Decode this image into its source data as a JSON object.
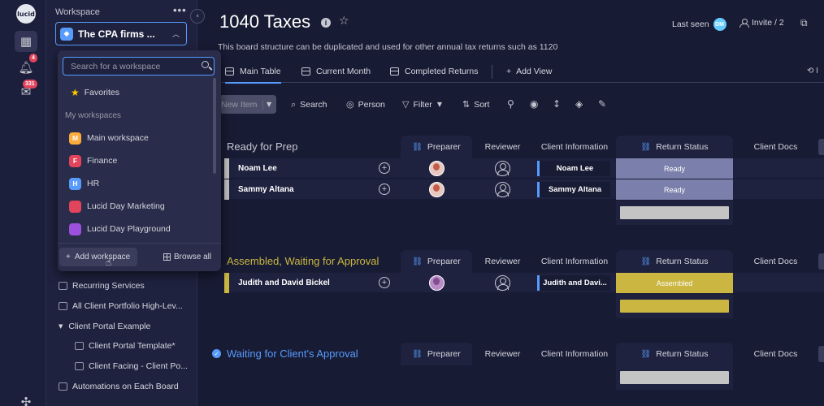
{
  "rail": {
    "logo": "lucid",
    "notifications_badge": "4",
    "inbox_badge": "331"
  },
  "workspace_panel": {
    "label": "Workspace",
    "selected_workspace": "The CPA firms ...",
    "items": [
      {
        "label": "Recurring Services"
      },
      {
        "label": "All Client Portfolio High-Lev..."
      },
      {
        "label": "Client Portal Example"
      },
      {
        "label": "Client Portal Template*"
      },
      {
        "label": "Client Facing - Client Po..."
      },
      {
        "label": "Automations on Each Board"
      }
    ]
  },
  "dropdown": {
    "search_placeholder": "Search for a workspace",
    "favorites": "Favorites",
    "section_label": "My workspaces",
    "workspaces": [
      {
        "initial": "M",
        "label": "Main workspace",
        "color": "#fdab3d"
      },
      {
        "initial": "F",
        "label": "Finance",
        "color": "#e2445c"
      },
      {
        "initial": "H",
        "label": "HR",
        "color": "#579bfc"
      },
      {
        "initial": "",
        "label": "Lucid Day Marketing",
        "color": "#e2445c"
      },
      {
        "initial": "",
        "label": "Lucid Day Playground",
        "color": "#9d50dd"
      }
    ],
    "add_workspace": "Add workspace",
    "browse_all": "Browse all"
  },
  "board": {
    "title": "1040 Taxes",
    "description": "This board structure can be duplicated and used for other annual tax returns such as 1120",
    "last_seen": "Last seen",
    "last_seen_avatar": "DM",
    "invite": "Invite / 2"
  },
  "tabs": [
    {
      "label": "Main Table"
    },
    {
      "label": "Current Month"
    },
    {
      "label": "Completed Returns"
    },
    {
      "label": "Add View"
    }
  ],
  "toolbar": {
    "new_item": "New Item",
    "search": "Search",
    "person": "Person",
    "filter": "Filter",
    "sort": "Sort"
  },
  "columns": {
    "preparer": "Preparer",
    "reviewer": "Reviewer",
    "client_information": "Client Information",
    "return_status": "Return Status",
    "client_docs": "Client Docs"
  },
  "groups": [
    {
      "title": "Ready for Prep",
      "color": "#c4c4c4",
      "rows": [
        {
          "name": "Noam Lee",
          "client_info": "Noam Lee",
          "status": "Ready",
          "status_color": "#7b7fab"
        },
        {
          "name": "Sammy Altana",
          "client_info": "Sammy Altana",
          "status": "Ready",
          "status_color": "#7b7fab"
        }
      ]
    },
    {
      "title": "Assembled, Waiting for Approval",
      "color": "#cab641",
      "rows": [
        {
          "name": "Judith and David Bickel",
          "client_info": "Judith and Davi...",
          "status": "Assembled",
          "status_color": "#cab641"
        }
      ]
    },
    {
      "title": "Waiting for Client's Approval",
      "color": "#579bfc",
      "rows": []
    }
  ]
}
